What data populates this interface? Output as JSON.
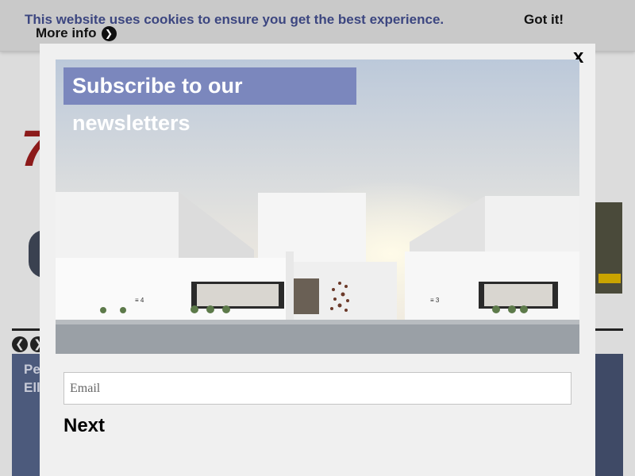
{
  "cookie_bar": {
    "message": "This website uses cookies to ensure you get the best experience.",
    "more_info_label": "More info",
    "more_info_icon": "chevron-right-icon",
    "accept_label": "Got it!"
  },
  "background": {
    "logo_fragment": "7",
    "card_text": "Pe\nEll",
    "prev_icon": "chevron-left-icon",
    "next_icon": "chevron-right-icon"
  },
  "modal": {
    "close_label": "x",
    "title": "Subscribe to our newsletters",
    "email_placeholder": "Email",
    "email_value": "",
    "next_label": "Next",
    "image_house_numbers": [
      "4",
      "3"
    ]
  },
  "colors": {
    "cookie_text": "#3c4680",
    "title_box": "#7b87bd",
    "modal_bg": "#f0f0f0"
  }
}
